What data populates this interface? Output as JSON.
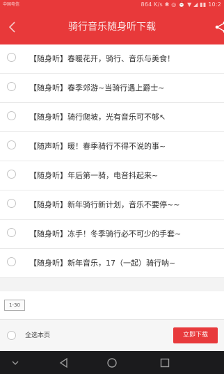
{
  "status_bar": {
    "left_text": "中国电信",
    "right_text": "864 K/s ✱ ◎ ⏰ ▼ ◢ ▮▮ 10:2"
  },
  "header": {
    "title": "骑行音乐随身听下载"
  },
  "list": {
    "items": [
      {
        "title": "【随身听】春暖花开，骑行、音乐与美食！"
      },
      {
        "title": "【随身听】春季郊游~当骑行遇上爵士~"
      },
      {
        "title": "【随身听】骑行爬坡，光有音乐可不够↖"
      },
      {
        "title": "【随声听】暖！春季骑行不得不说的事~"
      },
      {
        "title": "【随身听】年后第一骑，电音抖起来~"
      },
      {
        "title": "【随身听】新年骑行新计划，音乐不要停~~"
      },
      {
        "title": "【随身听】冻手！冬季骑行必不可少的手套~"
      },
      {
        "title": "【随身听】新年音乐，17（一起）骑行呐~"
      }
    ]
  },
  "pager": {
    "range_label": "1-30"
  },
  "bottom_bar": {
    "select_all_label": "全选本页",
    "download_label": "立即下载"
  },
  "colors": {
    "accent": "#e8393a",
    "nav_bar": "#1b1b1d"
  },
  "icons": {
    "back": "chevron-left-icon",
    "share": "share-icon",
    "nav": [
      "chevron-down-icon",
      "back-triangle-icon",
      "home-circle-icon",
      "recents-square-icon"
    ]
  }
}
